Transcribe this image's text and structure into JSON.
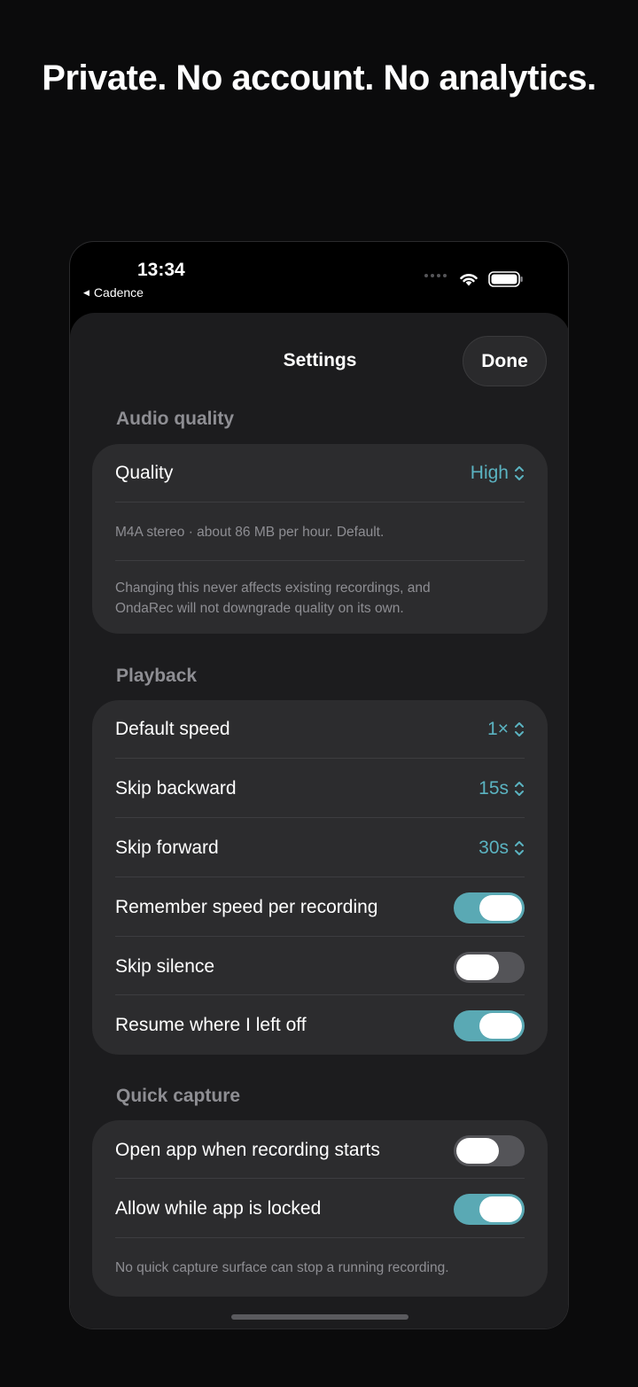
{
  "headline": "Private. No account. No analytics.",
  "status_bar": {
    "time": "13:34",
    "back_app": "Cadence"
  },
  "sheet": {
    "title": "Settings",
    "done_label": "Done"
  },
  "audio_quality": {
    "header": "Audio quality",
    "quality_label": "Quality",
    "quality_value": "High",
    "note_format": "M4A stereo · about 86 MB per hour. Default.",
    "note_line1": "Changing this never affects existing recordings, and",
    "note_line2": "OndaRec will not downgrade quality on its own."
  },
  "playback": {
    "header": "Playback",
    "default_speed_label": "Default speed",
    "default_speed_value": "1×",
    "skip_backward_label": "Skip backward",
    "skip_backward_value": "15s",
    "skip_forward_label": "Skip forward",
    "skip_forward_value": "30s",
    "remember_speed_label": "Remember speed per recording",
    "remember_speed_on": true,
    "skip_silence_label": "Skip silence",
    "skip_silence_on": false,
    "resume_label": "Resume where I left off",
    "resume_on": true
  },
  "quick_capture": {
    "header": "Quick capture",
    "open_app_label": "Open app when recording starts",
    "open_app_on": false,
    "allow_locked_label": "Allow while app is locked",
    "allow_locked_on": true,
    "note": "No quick capture surface can stop a running recording."
  },
  "colors": {
    "accent": "#5bb3c1",
    "toggle_on": "#5aa9b4",
    "card": "#2c2c2e",
    "sheet": "#1c1c1e"
  }
}
